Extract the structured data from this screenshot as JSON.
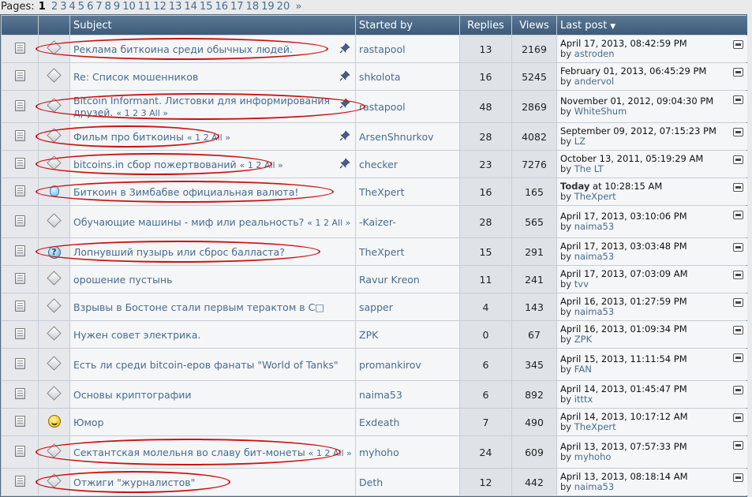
{
  "pagination": {
    "label": "Pages:",
    "current": "1",
    "pages": [
      "2",
      "3",
      "4",
      "5",
      "6",
      "7",
      "8",
      "9",
      "10",
      "11",
      "12",
      "13",
      "14",
      "15",
      "16",
      "17",
      "18",
      "19",
      "20"
    ],
    "next": "»"
  },
  "table": {
    "headers": {
      "subject": "Subject",
      "started_by": "Started by",
      "replies": "Replies",
      "views": "Views",
      "last_post": "Last post"
    },
    "rows": [
      {
        "title": "Реклама биткоина среди обычных людей.",
        "pages": "",
        "starter": "rastapool",
        "replies": "13",
        "views": "2169",
        "last_when": "April 17, 2013, 08:42:59 PM",
        "last_prefix": "",
        "last_by": "by",
        "last_user": "astroden",
        "icon": "diamond",
        "pinned": true,
        "circled": true
      },
      {
        "title": "Re: Список мошенников",
        "pages": "",
        "starter": "shkolota",
        "replies": "16",
        "views": "5245",
        "last_when": "February 01, 2013, 06:45:29 PM",
        "last_prefix": "",
        "last_by": "by",
        "last_user": "andervol",
        "icon": "diamond",
        "pinned": true,
        "circled": false
      },
      {
        "title": "Bitcoin Informant. Листовки для информирования друзей.",
        "pages": "« 1 2 3 All »",
        "starter": "rastapool",
        "replies": "48",
        "views": "2869",
        "last_when": "November 01, 2012, 09:04:30 PM",
        "last_prefix": "",
        "last_by": "by",
        "last_user": "WhiteShum",
        "icon": "diamond",
        "pinned": true,
        "circled": true
      },
      {
        "title": "Фильм про биткоины",
        "pages": "« 1 2 All »",
        "starter": "ArsenShnurkov",
        "replies": "28",
        "views": "4082",
        "last_when": "September 09, 2012, 07:15:23 PM",
        "last_prefix": "",
        "last_by": "by",
        "last_user": "LZ",
        "icon": "diamond",
        "pinned": true,
        "circled": true
      },
      {
        "title": "bitcoins.in сбор пожертвований",
        "pages": "« 1 2 All »",
        "starter": "checker",
        "replies": "23",
        "views": "7276",
        "last_when": "October 13, 2011, 05:19:29 AM",
        "last_prefix": "",
        "last_by": "by",
        "last_user": "The LT",
        "icon": "diamond",
        "pinned": true,
        "circled": true
      },
      {
        "title": "Биткоин в Зимбабве официальная валюта!",
        "pages": "",
        "starter": "TheXpert",
        "replies": "16",
        "views": "165",
        "last_when": "at 10:28:15 AM",
        "last_prefix": "Today",
        "last_by": "by",
        "last_user": "TheXpert",
        "icon": "bulb",
        "pinned": false,
        "circled": true
      },
      {
        "title": "Обучающие машины - миф или реальность?",
        "pages": "« 1 2 All »",
        "starter": "-Kaizer-",
        "replies": "28",
        "views": "565",
        "last_when": "April 17, 2013, 03:10:06 PM",
        "last_prefix": "",
        "last_by": "by",
        "last_user": "naima53",
        "icon": "diamond",
        "pinned": false,
        "circled": false
      },
      {
        "title": "Лопнувший пузырь или сброс балласта?",
        "pages": "",
        "starter": "TheXpert",
        "replies": "15",
        "views": "291",
        "last_when": "April 17, 2013, 03:03:48 PM",
        "last_prefix": "",
        "last_by": "by",
        "last_user": "naima53",
        "icon": "question",
        "pinned": false,
        "circled": true
      },
      {
        "title": "орошение пустынь",
        "pages": "",
        "starter": "Ravur Kreon",
        "replies": "11",
        "views": "241",
        "last_when": "April 17, 2013, 07:03:09 AM",
        "last_prefix": "",
        "last_by": "by",
        "last_user": "tvv",
        "icon": "diamond",
        "pinned": false,
        "circled": false
      },
      {
        "title": "Взрывы в Бостоне стали первым терактом в С□",
        "pages": "",
        "starter": "sapper",
        "replies": "4",
        "views": "143",
        "last_when": "April 16, 2013, 01:27:59 PM",
        "last_prefix": "",
        "last_by": "by",
        "last_user": "naima53",
        "icon": "diamond",
        "pinned": false,
        "circled": false
      },
      {
        "title": "Нужен совет электрика.",
        "pages": "",
        "starter": "ZPK",
        "replies": "0",
        "views": "67",
        "last_when": "April 16, 2013, 01:09:34 PM",
        "last_prefix": "",
        "last_by": "by",
        "last_user": "ZPK",
        "icon": "diamond",
        "pinned": false,
        "circled": false
      },
      {
        "title": "Есть ли среди bitcoin-еров фанаты \"World of Tanks\"",
        "pages": "",
        "starter": "promankirov",
        "replies": "6",
        "views": "345",
        "last_when": "April 15, 2013, 11:11:54 PM",
        "last_prefix": "",
        "last_by": "by",
        "last_user": "FAN",
        "icon": "diamond",
        "pinned": false,
        "circled": false
      },
      {
        "title": "Основы криптографии",
        "pages": "",
        "starter": "naima53",
        "replies": "6",
        "views": "892",
        "last_when": "April 14, 2013, 01:45:47 PM",
        "last_prefix": "",
        "last_by": "by",
        "last_user": "itttx",
        "icon": "diamond",
        "pinned": false,
        "circled": false
      },
      {
        "title": "Юмор",
        "pages": "",
        "starter": "Exdeath",
        "replies": "7",
        "views": "490",
        "last_when": "April 14, 2013, 10:17:12 AM",
        "last_prefix": "",
        "last_by": "by",
        "last_user": "TheXpert",
        "icon": "smile",
        "pinned": false,
        "circled": false
      },
      {
        "title": "Сектантская молельня во славу бит-монеты",
        "pages": "« 1 2 All »",
        "starter": "myhoho",
        "replies": "24",
        "views": "609",
        "last_when": "April 13, 2013, 07:57:33 PM",
        "last_prefix": "",
        "last_by": "by",
        "last_user": "myhoho",
        "icon": "diamond",
        "pinned": false,
        "circled": true
      },
      {
        "title": "Отжиги \"журналистов\"",
        "pages": "",
        "starter": "Deth",
        "replies": "12",
        "views": "442",
        "last_when": "April 13, 2013, 08:18:14 AM",
        "last_prefix": "",
        "last_by": "by",
        "last_user": "naima53",
        "icon": "diamond",
        "pinned": false,
        "circled": true
      }
    ]
  },
  "colors": {
    "header_bg": "#4a6885",
    "link": "#476c8e",
    "annotation": "#cc1111"
  }
}
